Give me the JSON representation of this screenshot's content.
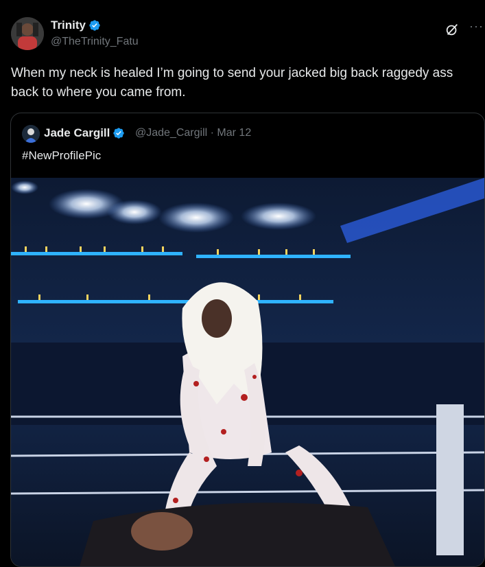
{
  "tweet": {
    "author_name": "Trinity",
    "author_handle": "@TheTrinity_Fatu",
    "text": "When my neck is healed I’m going to send your jacked big back raggedy ass back to where you came from.",
    "more_label": "···"
  },
  "quote": {
    "author_name": "Jade Cargill",
    "author_handle": "@Jade_Cargill",
    "date": "Mar 12",
    "separator": "·",
    "text": "#NewProfilePic"
  },
  "icons": {
    "verified": "verified-badge-icon",
    "grok": "grok-icon",
    "more": "more-options-icon"
  },
  "colors": {
    "background": "#000000",
    "text_primary": "#e7e9ea",
    "text_secondary": "#71767b",
    "verified_blue": "#1d9bf0",
    "border": "#2f3336"
  }
}
